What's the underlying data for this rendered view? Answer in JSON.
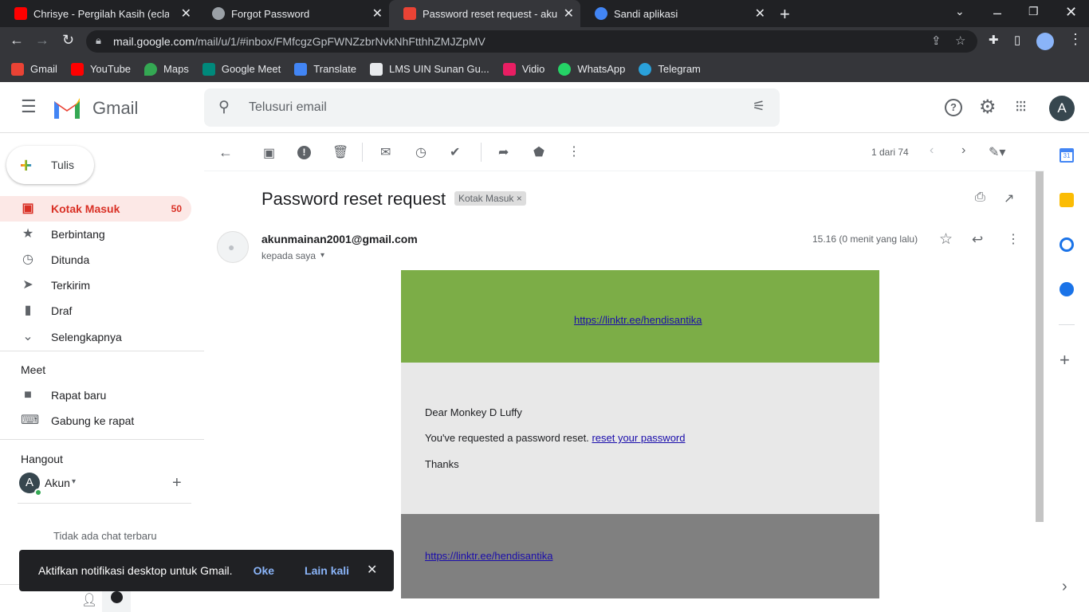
{
  "browser": {
    "tabs": [
      {
        "title": "Chrisye - Pergilah Kasih (eclat cover)",
        "color": "#ff0000"
      },
      {
        "title": "Forgot Password",
        "color": "#9aa0a6"
      },
      {
        "title": "Password reset request - akunmainan",
        "color": "#ea4335"
      },
      {
        "title": "Sandi aplikasi",
        "color": "#4285f4"
      }
    ],
    "url_host": "mail.google.com",
    "url_path": "/mail/u/1/#inbox/FMfcgzGpFWNZzbrNvkNhFtthhZMJZpMV",
    "bookmarks": [
      "Gmail",
      "YouTube",
      "Maps",
      "Google Meet",
      "Translate",
      "LMS UIN Sunan Gu...",
      "Vidio",
      "WhatsApp",
      "Telegram"
    ]
  },
  "gmail": {
    "logo": "Gmail",
    "search_placeholder": "Telusuri email",
    "avatar": "A",
    "compose": "Tulis",
    "nav": [
      {
        "label": "Kotak Masuk",
        "count": "50",
        "icon": "inbox-icon"
      },
      {
        "label": "Berbintang",
        "icon": "star-icon"
      },
      {
        "label": "Ditunda",
        "icon": "clock-icon"
      },
      {
        "label": "Terkirim",
        "icon": "send-icon"
      },
      {
        "label": "Draf",
        "icon": "draft-icon"
      },
      {
        "label": "Selengkapnya",
        "icon": "chevron-down-icon"
      }
    ],
    "meet_title": "Meet",
    "meet_items": [
      "Rapat baru",
      "Gabung ke rapat"
    ],
    "hangout_title": "Hangout",
    "hangout_user": "Akun",
    "no_chat": "Tidak ada chat terbaru",
    "pager": "1 dari 74"
  },
  "email": {
    "subject": "Password reset request",
    "label": "Kotak Masuk",
    "sender": "akunmainan2001@gmail.com",
    "to": "kepada saya",
    "time": "15.16 (0 menit yang lalu)",
    "header_link": "https://linktr.ee/hendisantika",
    "greeting": "Dear Monkey D Luffy",
    "line": "You've requested a password reset.",
    "reset_link": "reset your password",
    "thanks": "Thanks",
    "footer_link": "https://linktr.ee/hendisantika",
    "colors": {
      "header": "#7cad47",
      "body": "#e8e8e8",
      "footer": "#808080"
    }
  },
  "snackbar": {
    "text": "Aktifkan notifikasi desktop untuk Gmail.",
    "ok": "Oke",
    "later": "Lain kali"
  }
}
